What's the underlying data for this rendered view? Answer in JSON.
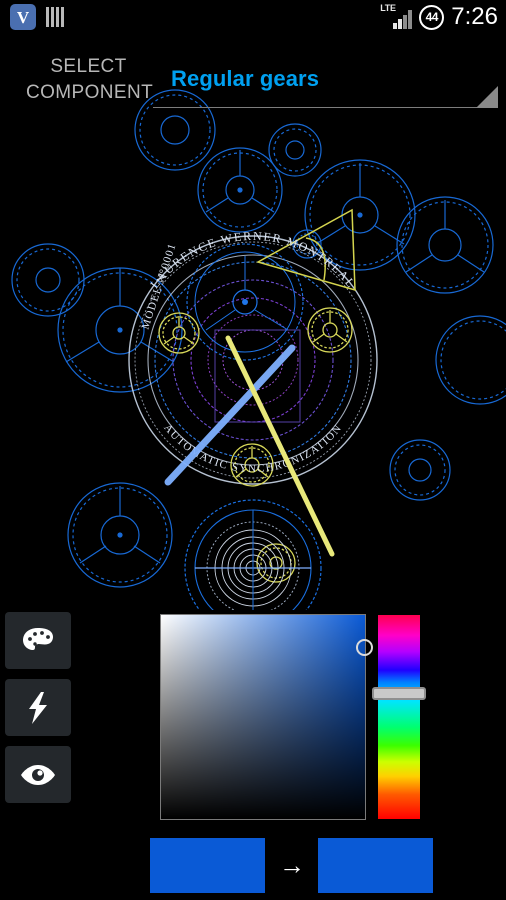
{
  "status_bar": {
    "app_icon_letter": "V",
    "app_icon_name": "vignette-app-icon",
    "bars_icon_name": "equalizer-bars-icon",
    "network_type": "LTE",
    "signal_icon_name": "signal-bars-icon",
    "battery_percent": "44",
    "time": "7:26"
  },
  "header": {
    "select_label": "SELECT COMPONENT",
    "spinner_value": "Regular gears",
    "spinner_options": [
      "Regular gears"
    ],
    "accent_color": "#00a0f0"
  },
  "artwork": {
    "name": "watch-blueprint",
    "brand_text": "LAURENCE WERNER MONTREAL",
    "model_text": "MODEL N°0001",
    "bottom_text": "AUTOMATIC SYNCHRONIZATION",
    "line_color": "#1a6fe0",
    "highlight_color": "#d8d85a",
    "hand_color": "#7fb0ff",
    "second_hand_color": "#e8e87a"
  },
  "tools": [
    {
      "name": "palette-button",
      "icon": "palette-icon",
      "label": "Palette"
    },
    {
      "name": "lightning-button",
      "icon": "lightning-bolt-icon",
      "label": "Effects"
    },
    {
      "name": "visibility-button",
      "icon": "eye-icon",
      "label": "Preview"
    }
  ],
  "color_picker": {
    "sv_box_name": "saturation-value-box",
    "cursor_name": "sv-cursor",
    "hue_slider_name": "hue-slider",
    "hue_handle_name": "hue-slider-handle",
    "selected_color": "#0a5ad6",
    "old_color": "#0a5ad6",
    "new_color": "#0a5ad6",
    "arrow_glyph": "→"
  }
}
